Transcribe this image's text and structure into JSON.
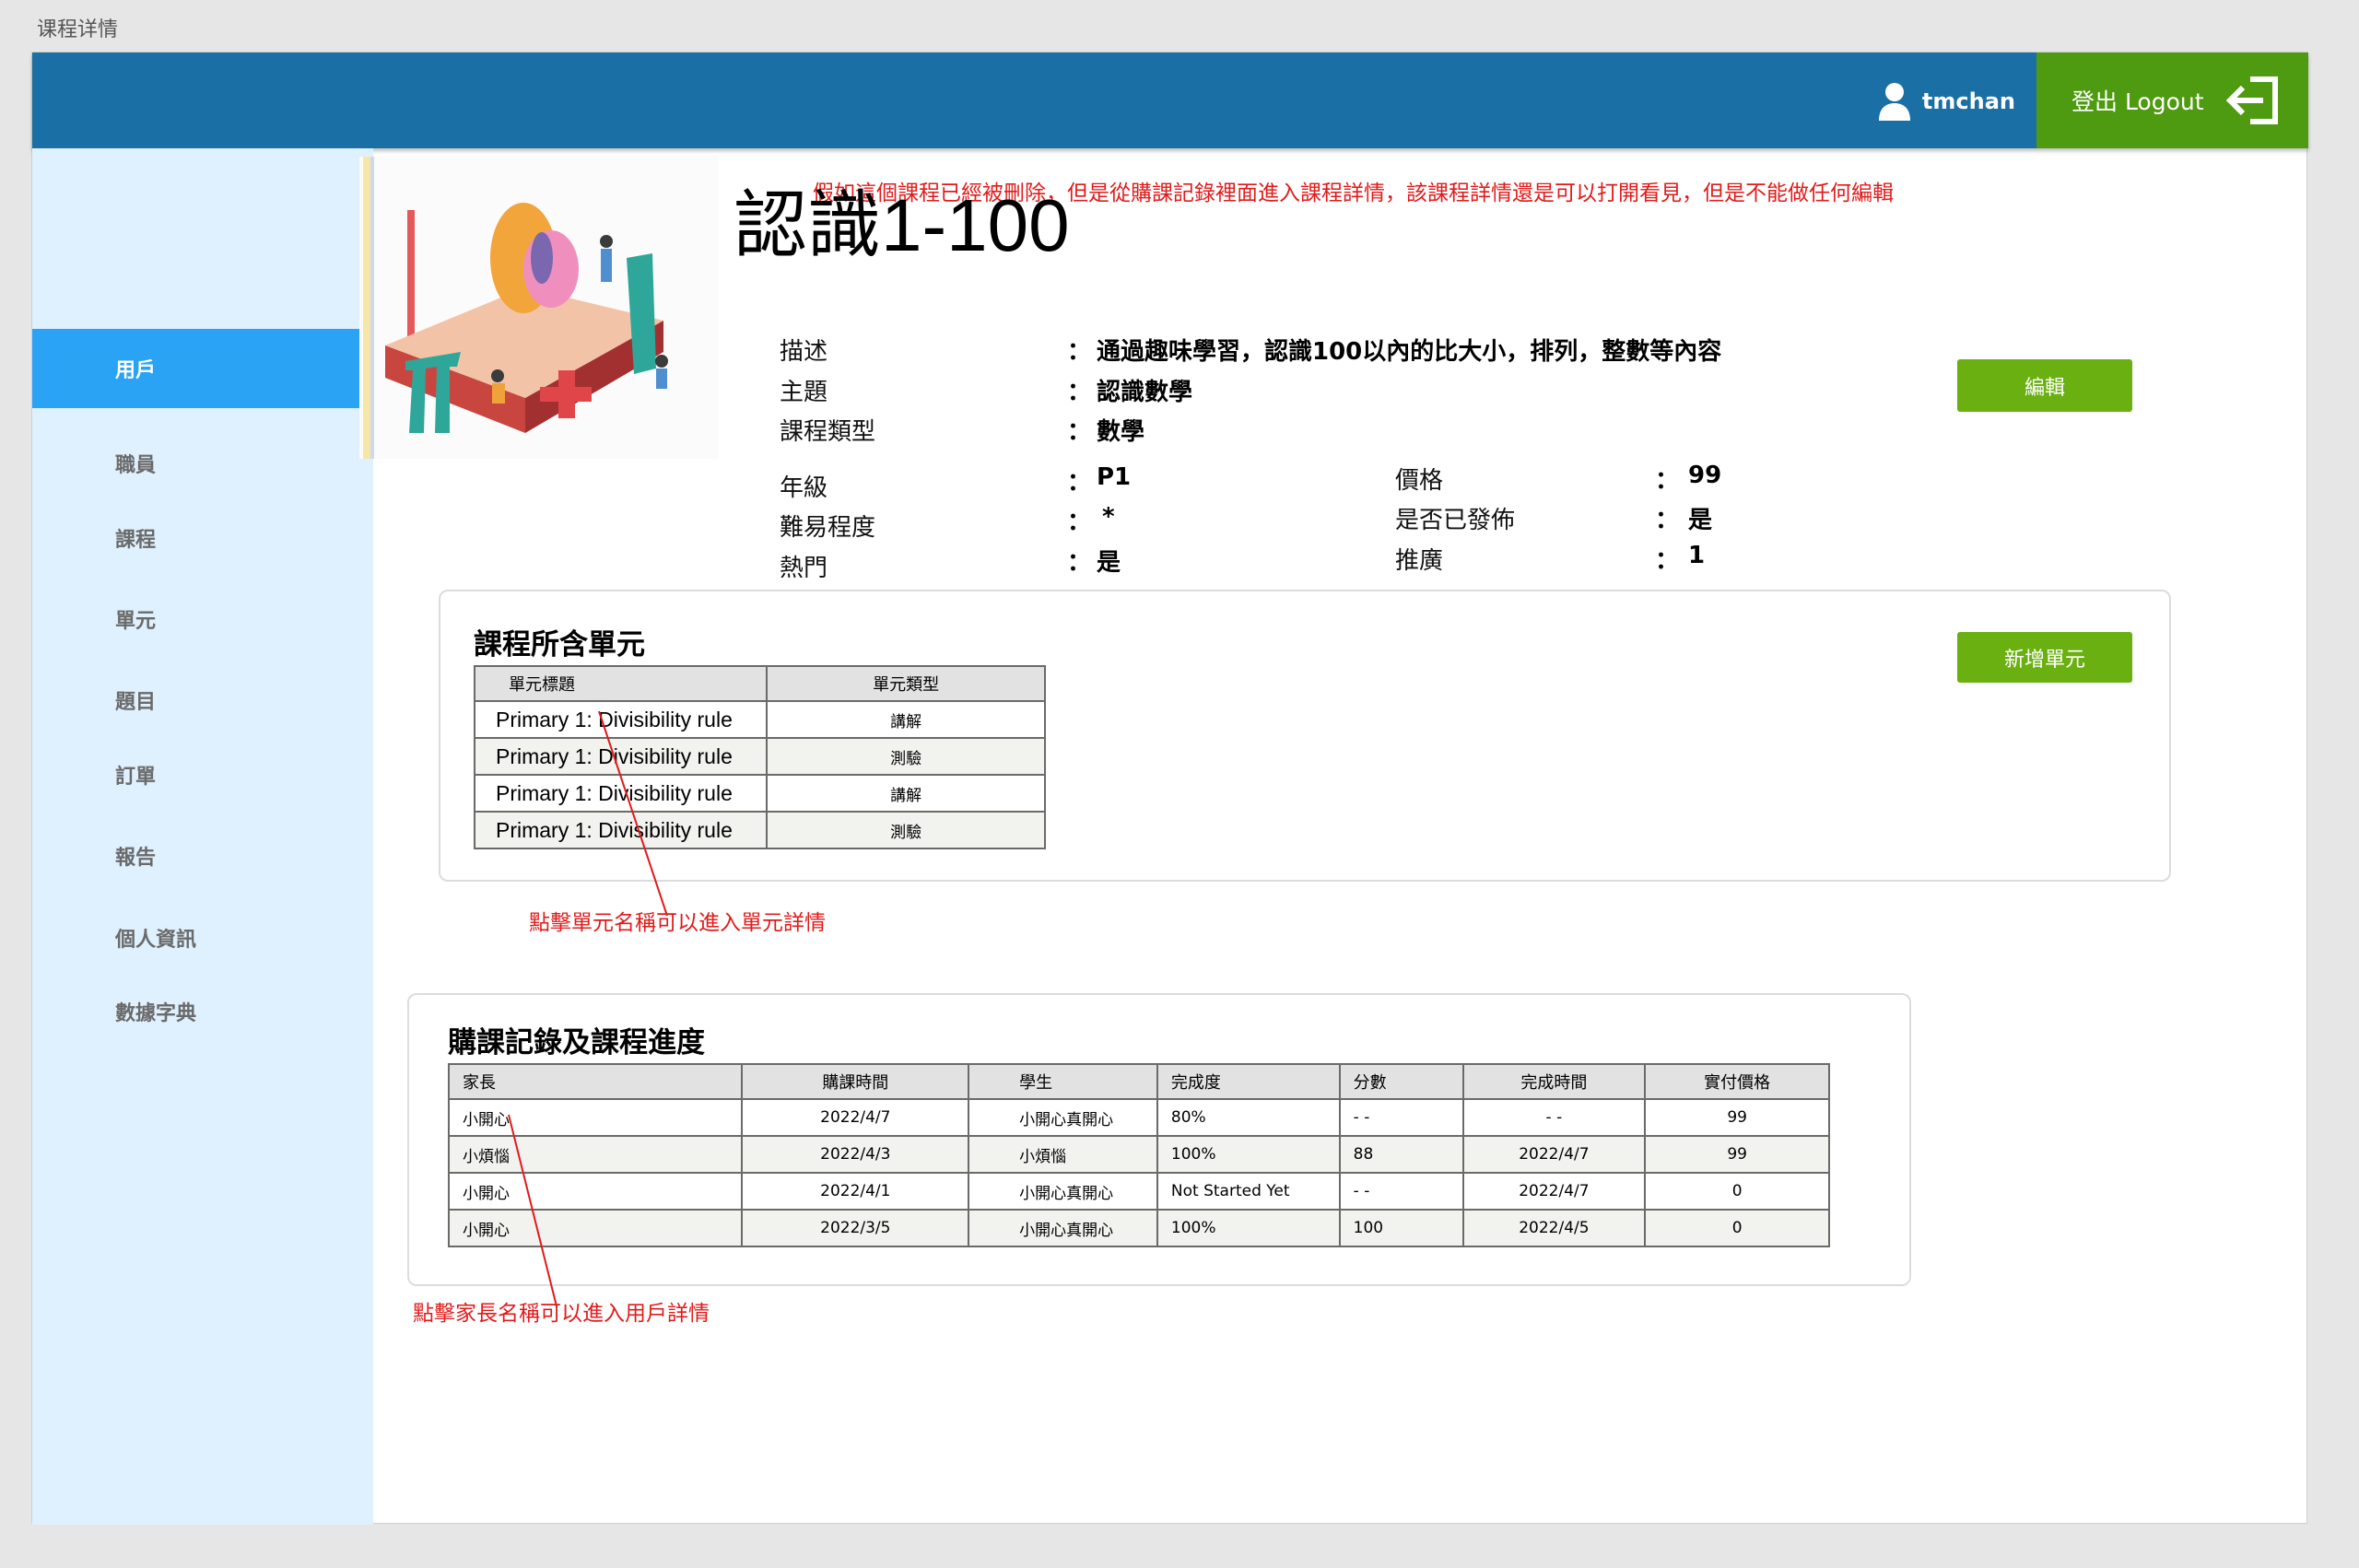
{
  "page_label": "课程详情",
  "header": {
    "username": "tmchan",
    "logout_label": "登出 Logout"
  },
  "sidebar": {
    "items": [
      {
        "label": "用戶",
        "active": true
      },
      {
        "label": "職員"
      },
      {
        "label": "課程"
      },
      {
        "label": "單元"
      },
      {
        "label": "題目"
      },
      {
        "label": "訂單"
      },
      {
        "label": "報告"
      },
      {
        "label": "個人資訊"
      },
      {
        "label": "數據字典"
      }
    ]
  },
  "notes": {
    "deleted_course": "假如這個課程已經被刪除，但是從購課記錄裡面進入課程詳情，該課程詳情還是可以打開看見，但是不能做任何編輯",
    "unit_link": "點擊單元名稱可以進入單元詳情",
    "parent_link": "點擊家長名稱可以進入用戶詳情"
  },
  "course": {
    "title": "認識1-100",
    "colon": "：",
    "description_label": "描述",
    "description": "通過趣味學習，認識100以內的比大小，排列，整數等內容",
    "topic_label": "主題",
    "topic": "認識數學",
    "category_label": "課程類型",
    "category": "數學",
    "grade_label": "年級",
    "grade": "P1",
    "difficulty_label": "難易程度",
    "difficulty": "*",
    "hot_label": "熱門",
    "hot": "是",
    "price_label": "價格",
    "price": "99",
    "published_label": "是否已發佈",
    "published": "是",
    "promotion_label": "推廣",
    "promotion": "1",
    "edit_button": "編輯"
  },
  "units_card": {
    "title": "課程所含單元",
    "add_button": "新增單元",
    "headers": [
      "單元標題",
      "單元類型"
    ],
    "rows": [
      {
        "title": "Primary 1: Divisibility rule",
        "type": "講解"
      },
      {
        "title": "Primary 1: Divisibility rule",
        "type": "測驗"
      },
      {
        "title": "Primary 1: Divisibility rule",
        "type": "講解"
      },
      {
        "title": "Primary 1: Divisibility rule",
        "type": "測驗"
      }
    ]
  },
  "orders_card": {
    "title": "購課記錄及課程進度",
    "headers": [
      "家長",
      "購課時間",
      "學生",
      "完成度",
      "分數",
      "完成時間",
      "實付價格"
    ],
    "rows": [
      {
        "parent": "小開心",
        "date": "2022/4/7",
        "student": "小開心真開心",
        "progress": "80%",
        "score": "- -",
        "completed": "- -",
        "paid": "99"
      },
      {
        "parent": "小煩惱",
        "date": "2022/4/3",
        "student": "小煩惱",
        "progress": "100%",
        "score": "88",
        "completed": "2022/4/7",
        "paid": "99"
      },
      {
        "parent": "小開心",
        "date": "2022/4/1",
        "student": "小開心真開心",
        "progress": "Not Started Yet",
        "score": "- -",
        "completed": "2022/4/7",
        "paid": "0"
      },
      {
        "parent": "小開心",
        "date": "2022/3/5",
        "student": "小開心真開心",
        "progress": "100%",
        "score": "100",
        "completed": "2022/4/5",
        "paid": "0"
      }
    ]
  },
  "colors": {
    "header": "#1a6fa5",
    "logout": "#4e9a10",
    "button": "#6ab011",
    "sidebar": "#dff0fe",
    "active": "#2aa3f5",
    "note": "#e01b1b"
  },
  "icons": [
    "user-icon",
    "logout-icon",
    "course-illustration"
  ]
}
